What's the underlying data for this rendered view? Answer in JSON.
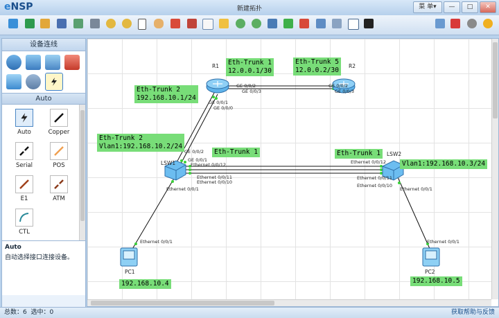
{
  "app": {
    "name": "eNSP",
    "document_title": "新建拓扑"
  },
  "window": {
    "menu_label": "菜 单▾",
    "min": "—",
    "max": "□",
    "close": "✕"
  },
  "toolbar": {
    "icons": [
      "new-topology-icon",
      "new-example-icon",
      "open-icon",
      "save-icon",
      "save-as-icon",
      "print-icon",
      "undo-icon",
      "redo-icon",
      "select-icon",
      "pan-icon",
      "delete-icon",
      "delete-all-links-icon",
      "text-icon",
      "palette-icon",
      "zoom-in-icon",
      "zoom-out-icon",
      "reset-zoom-icon",
      "start-device-icon",
      "stop-device-icon",
      "collect-data-icon",
      "topology-icon",
      "capture-icon",
      "command-line-icon",
      "forum-icon",
      "huawei-site-icon",
      "settings-icon",
      "help-icon"
    ]
  },
  "left_panel": {
    "title": "设备连线",
    "device_icons": [
      "router-icon",
      "switch-icon",
      "wireless-icon",
      "firewall-icon",
      "pc-icon",
      "cloud-icon",
      "connection-icon"
    ],
    "category_label": "Auto",
    "cables": [
      {
        "label": "Auto"
      },
      {
        "label": "Copper"
      },
      {
        "label": "Serial"
      },
      {
        "label": "POS"
      },
      {
        "label": "E1"
      },
      {
        "label": "ATM"
      },
      {
        "label": "CTL"
      }
    ],
    "desc_title": "Auto",
    "desc_text": "自动选择接口连接设备。"
  },
  "topology": {
    "devices": {
      "r1": "R1",
      "r2": "R2",
      "lsw1": "LSW1",
      "lsw2": "LSW2",
      "pc1": "PC1",
      "pc2": "PC2"
    },
    "labels": {
      "r1_trunk": "Eth-Trunk 1\n12.0.0.1/30",
      "r2_trunk": "Eth-Trunk 5\n12.0.0.2/30",
      "r1_trunk2": "Eth-Trunk 2\n192.168.10.1/24",
      "lsw1_trunk2": "Eth-Trunk 2\nVlan1:192.168.10.2/24",
      "lsw1_trunk1": "Eth-Trunk 1",
      "lsw2_trunk1": "Eth-Trunk 1",
      "lsw2_vlan": "Vlan1:192.168.10.3/24",
      "pc1_ip": "192.168.10.4",
      "pc2_ip": "192.168.10.5"
    },
    "ports": {
      "r1_ge002": "GE 0/0/2",
      "r1_ge003": "GE 0/0/3",
      "r2_ge002": "GE 0/0/2",
      "r2_ge003": "GE 0/0/3",
      "r1_ge001": "GE 0/0/1",
      "r1_ge000": "GE 0/0/0",
      "lsw1_ge002": "GE 0/0/2",
      "lsw1_ge001": "GE 0/0/1",
      "lsw1_e012": "Ethernet 0/0/12",
      "lsw1_e011": "Ethernet 0/0/11",
      "lsw1_e010": "Ethernet 0/0/10",
      "lsw1_e01": "Ethernet 0/0/1",
      "lsw2_e012": "Ethernet 0/0/12",
      "lsw2_e011": "Ethernet 0/0/11",
      "lsw2_e010": "Ethernet 0/0/10",
      "lsw2_e01": "Ethernet 0/0/1",
      "pc1_e01": "Ethernet 0/0/1",
      "pc2_e01": "Ethernet 0/0/1"
    }
  },
  "status": {
    "left": "总数：6  选中：0",
    "right": "获取帮助与反馈"
  }
}
